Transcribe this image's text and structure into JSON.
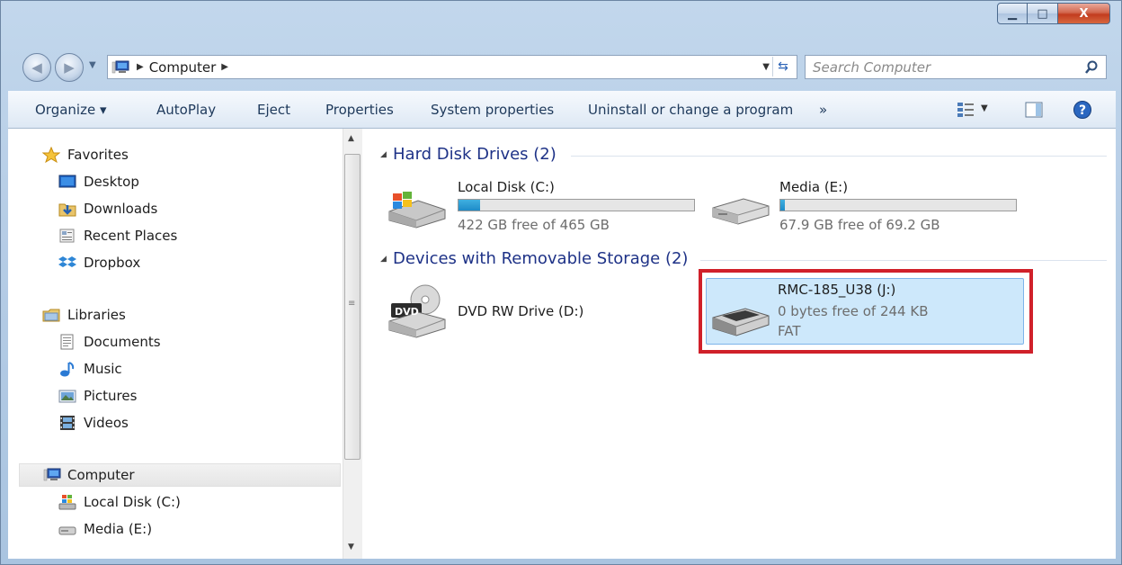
{
  "window": {
    "buttons": {
      "minimize": "▁",
      "maximize": "□",
      "close": "X"
    }
  },
  "address": {
    "path": "Computer",
    "separator": "▶"
  },
  "search": {
    "placeholder": "Search Computer"
  },
  "toolbar": {
    "organize": "Organize ▾",
    "autoplay": "AutoPlay",
    "eject": "Eject",
    "properties": "Properties",
    "system_properties": "System properties",
    "uninstall": "Uninstall or change a program",
    "more": "»"
  },
  "nav": {
    "favorites": "Favorites",
    "desktop": "Desktop",
    "downloads": "Downloads",
    "recent": "Recent Places",
    "dropbox": "Dropbox",
    "libraries": "Libraries",
    "documents": "Documents",
    "music": "Music",
    "pictures": "Pictures",
    "videos": "Videos",
    "computer": "Computer",
    "local_disk": "Local Disk (C:)",
    "media": "Media (E:)"
  },
  "groups": {
    "hdd": "Hard Disk Drives (2)",
    "removable": "Devices with Removable Storage (2)"
  },
  "drives": {
    "c": {
      "name": "Local Disk (C:)",
      "free": "422 GB free of 465 GB",
      "used_fraction": 0.09
    },
    "e": {
      "name": "Media (E:)",
      "free": "67.9 GB free of 69.2 GB",
      "used_fraction": 0.02
    },
    "d": {
      "name": "DVD RW Drive (D:)",
      "badge": "DVD"
    },
    "j": {
      "name": "RMC-185_U38 (J:)",
      "free": "0 bytes free of 244 KB",
      "fs": "FAT"
    }
  },
  "colors": {
    "selection": "#cde8fb",
    "highlight_box": "#d0202a",
    "group_header": "#1e3287"
  }
}
